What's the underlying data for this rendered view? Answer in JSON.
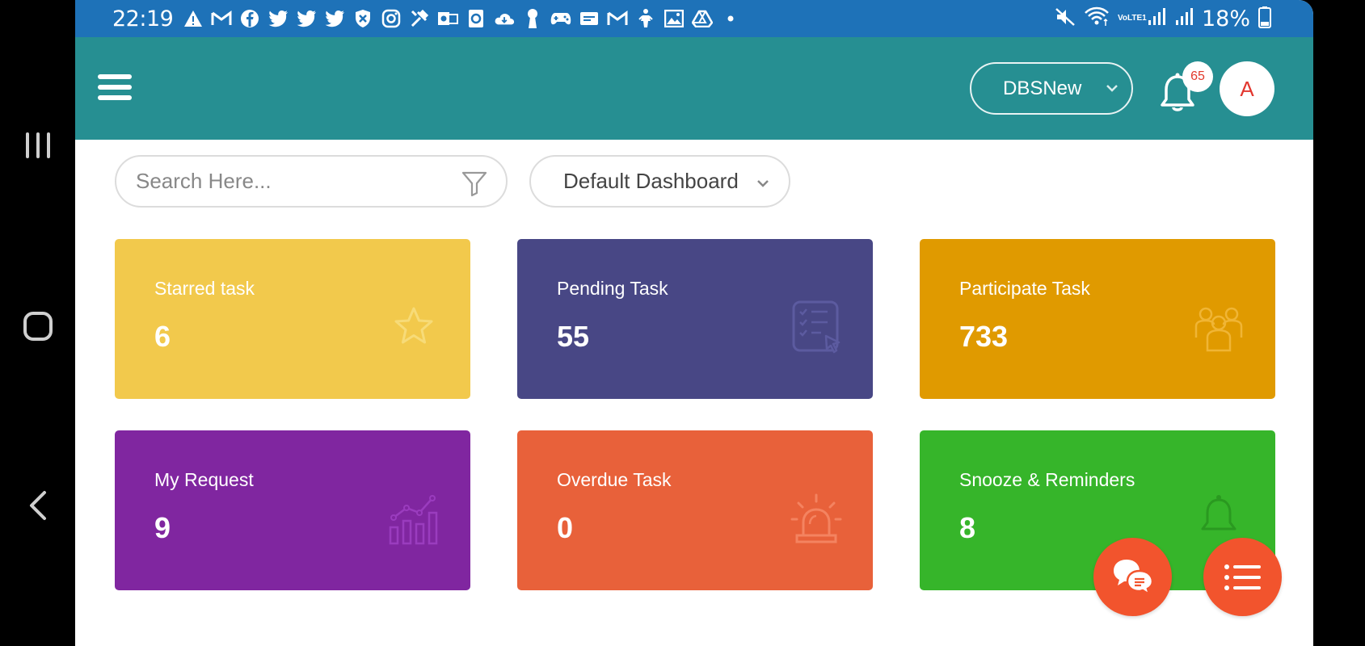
{
  "status_bar": {
    "time": "22:19",
    "battery": "18%",
    "notification_icons": [
      "alert-icon",
      "gmail-icon",
      "facebook-icon",
      "twitter-icon",
      "twitter-icon",
      "twitter-icon",
      "shield-icon",
      "instagram-icon",
      "tool-icon",
      "outlook-icon",
      "app-icon",
      "cloud-icon",
      "keyhole-icon",
      "gamepad-icon",
      "sim-icon",
      "gmail-icon",
      "figure-icon",
      "image-icon",
      "drive-icon",
      "dot-icon"
    ],
    "right_icons": [
      "mute-icon",
      "wifi-icon",
      "volte-label",
      "signal-icon",
      "signal-icon",
      "battery-icon"
    ],
    "volte_label": "VoLTE1"
  },
  "header": {
    "org_selector": "DBSNew",
    "notification_count": "65",
    "avatar_letter": "A"
  },
  "toolbar": {
    "search_placeholder": "Search Here...",
    "dashboard_selector": "Default Dashboard"
  },
  "cards": [
    {
      "label": "Starred task",
      "value": "6",
      "color": "#f2c94c",
      "icon": "star-icon"
    },
    {
      "label": "Pending Task",
      "value": "55",
      "color": "#484785",
      "icon": "checklist-icon"
    },
    {
      "label": "Participate Task",
      "value": "733",
      "color": "#e09a00",
      "icon": "group-icon"
    },
    {
      "label": "My Request",
      "value": "9",
      "color": "#8026a0",
      "icon": "chart-icon"
    },
    {
      "label": "Overdue Task",
      "value": "0",
      "color": "#e8613a",
      "icon": "siren-icon"
    },
    {
      "label": "Snooze & Reminders",
      "value": "8",
      "color": "#36b52a",
      "icon": "bell-icon"
    }
  ],
  "colors": {
    "status_bar": "#1e72b8",
    "app_bar": "#268f92",
    "fab": "#f2542d"
  }
}
